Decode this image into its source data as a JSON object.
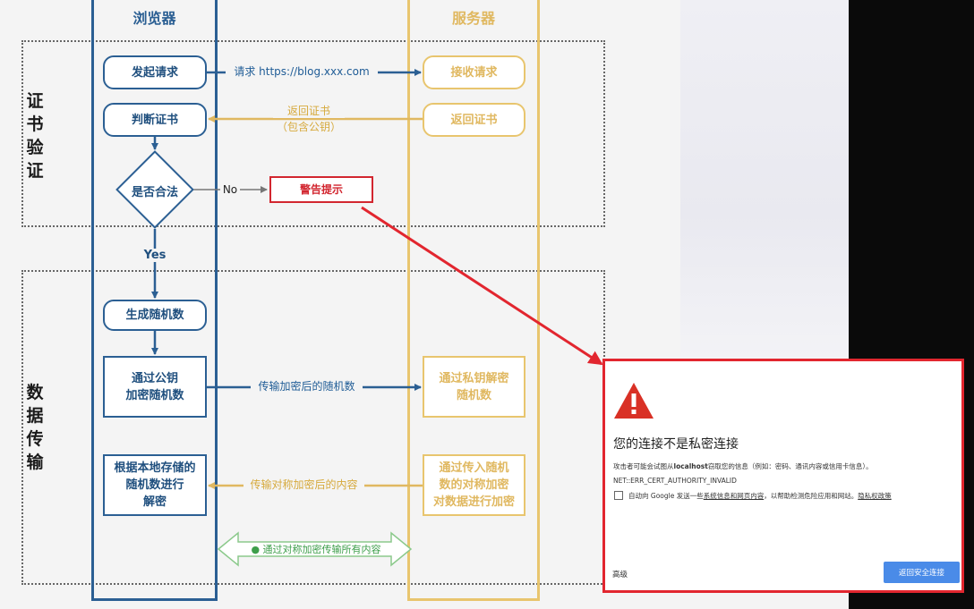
{
  "diagram": {
    "lanes": {
      "browser": "浏览器",
      "server": "服务器"
    },
    "groups": {
      "cert_verify": "证\n书\n验\n证",
      "data_transfer": "数\n据\n传\n输"
    },
    "browser_nodes": {
      "send_request": "发起请求",
      "check_cert": "判断证书",
      "is_valid": "是否合法",
      "gen_random": "生成随机数",
      "encrypt_random": "通过公钥\n加密随机数",
      "decrypt_local": "根据本地存储的\n随机数进行\n解密"
    },
    "server_nodes": {
      "receive_request": "接收请求",
      "return_cert": "返回证书",
      "decrypt_private": "通过私钥解密\n随机数",
      "encrypt_content": "通过传入随机\n数的对称加密\n对数据进行加密"
    },
    "warning_node": "警告提示",
    "messages": {
      "request": "请求 https://blog.xxx.com",
      "return_cert": "返回证书",
      "return_cert_sub": "（包含公钥）",
      "no": "No",
      "yes": "Yes",
      "send_encrypted_random": "传输加密后的随机数",
      "send_sym_encrypted": "传输对称加密后的内容",
      "sym_all": "● 通过对称加密传输所有内容"
    },
    "colors": {
      "browser": "#2b5f93",
      "server": "#e8c56e",
      "alert": "#e2262f",
      "sym": "#4caf50"
    }
  },
  "browser_warning": {
    "title": "您的连接不是私密连接",
    "desc_prefix": "攻击者可能会试图从",
    "desc_host": "localhost",
    "desc_suffix": "窃取您的信息（例如：密码、通讯内容或信用卡信息）。",
    "error_code": "NET::ERR_CERT_AUTHORITY_INVALID",
    "checkbox_prefix": "自动向 Google 发送一些",
    "checkbox_link": "系统信息和网页内容",
    "checkbox_suffix": "，以帮助检测危险应用和网站。",
    "privacy_link": "隐私权政策",
    "advanced": "高级",
    "back_button": "返回安全连接",
    "icon": "warning-triangle-icon"
  }
}
